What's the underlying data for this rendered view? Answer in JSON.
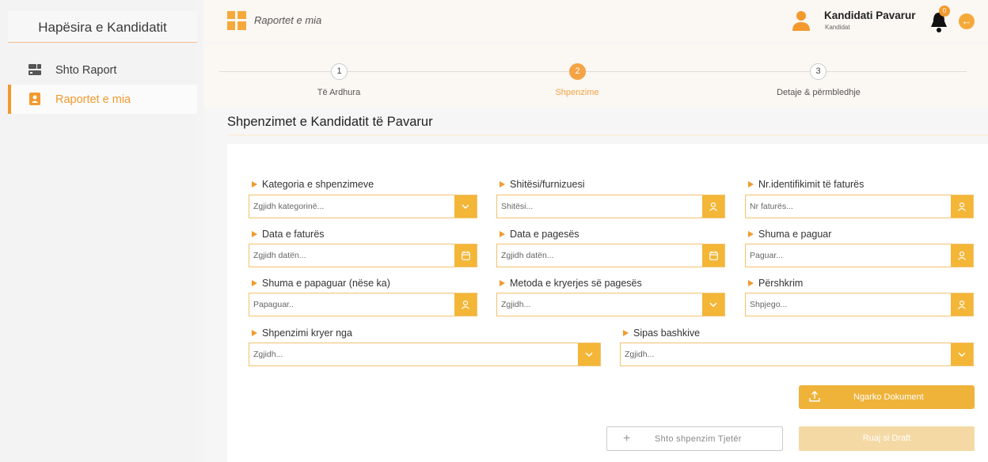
{
  "sidebar": {
    "title": "Hapësira e Kandidatit",
    "items": [
      {
        "label": "Shto Raport",
        "icon": "add-report-icon"
      },
      {
        "label": "Raportet e mia",
        "icon": "reports-icon"
      }
    ]
  },
  "header": {
    "breadcrumb": "Raportet e mia",
    "user_name": "Kandidati Pavarur",
    "user_role": "Kandidat",
    "notification_count": "0"
  },
  "stepper": {
    "steps": [
      {
        "number": "1",
        "label": "Të Ardhura"
      },
      {
        "number": "2",
        "label": "Shpenzime"
      },
      {
        "number": "3",
        "label": "Detaje & përmbledhje"
      }
    ],
    "active_step": 2
  },
  "page": {
    "title": "Shpenzimet e Kandidatit të Pavarur"
  },
  "form": {
    "fields": [
      {
        "label": "Kategoria e shpenzimeve",
        "placeholder": "Zgjidh kategorinë...",
        "icon": "chevron-down-icon"
      },
      {
        "label": "Shitësi/furnizuesi",
        "placeholder": "Shitësi...",
        "icon": "user-icon"
      },
      {
        "label": "Nr.identifikimit të faturës",
        "placeholder": "Nr faturës...",
        "icon": "user-icon"
      },
      {
        "label": "Data e faturës",
        "placeholder": "Zgjidh datën...",
        "icon": "calendar-icon"
      },
      {
        "label": "Data e pagesës",
        "placeholder": "Zgjidh datën...",
        "icon": "calendar-icon"
      },
      {
        "label": "Shuma e paguar",
        "placeholder": "Paguar...",
        "icon": "user-icon"
      },
      {
        "label": "Shuma e papaguar (nëse ka)",
        "placeholder": "Papaguar..",
        "icon": "user-icon"
      },
      {
        "label": "Metoda e kryerjes së pagesës",
        "placeholder": "Zgjidh...",
        "icon": "chevron-down-icon"
      },
      {
        "label": "Përshkrim",
        "placeholder": "Shpjego...",
        "icon": "user-icon"
      },
      {
        "label": "Shpenzimi kryer nga",
        "placeholder": "Zgjidh...",
        "icon": "chevron-down-icon"
      },
      {
        "label": "Sipas bashkive",
        "placeholder": "Zgjidh...",
        "icon": "chevron-down-icon"
      }
    ]
  },
  "buttons": {
    "upload": "Ngarko Dokument",
    "add_expense": "Shto shpenzim Tjetër",
    "save_draft": "Ruaj si Draft"
  },
  "colors": {
    "accent": "#f29a2e",
    "field_button": "#f3b636",
    "field_border": "#f2c26e"
  }
}
